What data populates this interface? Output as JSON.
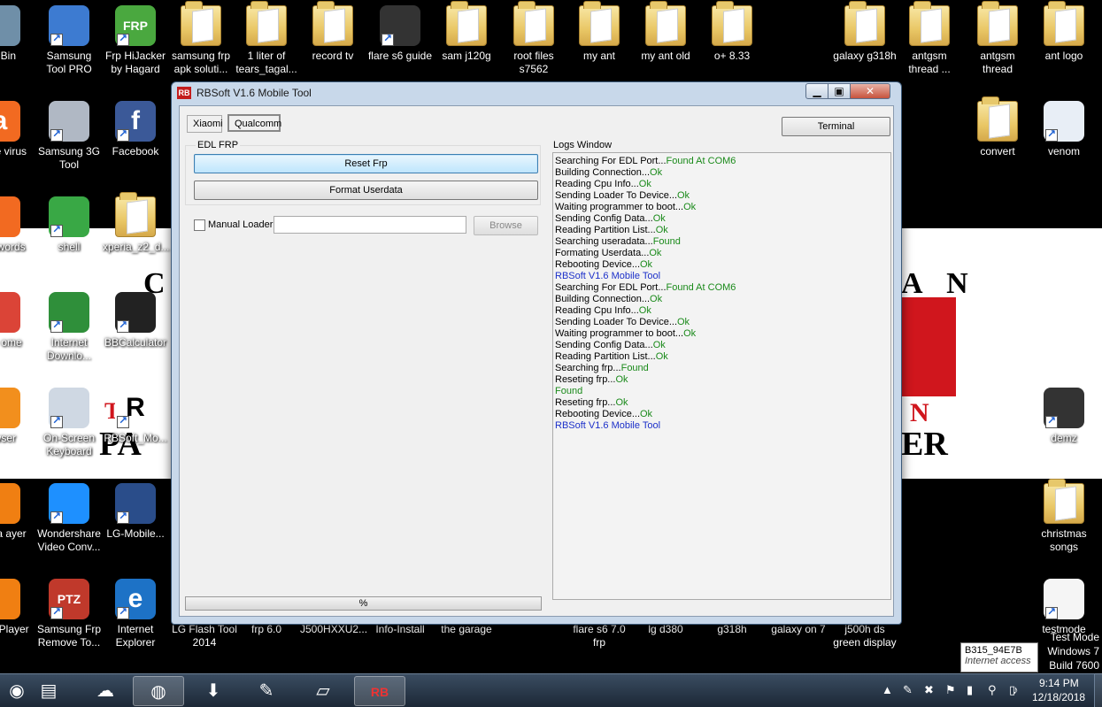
{
  "desktop": {
    "icons": [
      {
        "label": "cle Bin",
        "icon": "recycle-bin-icon"
      },
      {
        "label": "Samsung Tool PRO",
        "icon": "samsung-tool-icon"
      },
      {
        "label": "Frp HiJacker by Hagard",
        "icon": "frp-icon",
        "glyph": "FRP"
      },
      {
        "label": "samsung frp apk soluti...",
        "icon": "folder-icon"
      },
      {
        "label": "1 liter of tears_tagal...",
        "icon": "folder-icon"
      },
      {
        "label": "record tv",
        "icon": "folder-icon"
      },
      {
        "label": "flare s6 guide",
        "icon": "screenshot-icon"
      },
      {
        "label": "sam j120g",
        "icon": "folder-icon"
      },
      {
        "label": "root files s7562",
        "icon": "folder-icon"
      },
      {
        "label": "my ant",
        "icon": "folder-icon"
      },
      {
        "label": "my ant old",
        "icon": "folder-icon"
      },
      {
        "label": "o+ 8.33",
        "icon": "folder-icon"
      },
      {
        "label": "galaxy g318h",
        "icon": "folder-icon"
      },
      {
        "label": "antgsm thread ...",
        "icon": "folder-icon"
      },
      {
        "label": "antgsm thread",
        "icon": "folder-icon"
      },
      {
        "label": "ant logo",
        "icon": "folder-icon"
      },
      {
        "label": "t Free virus",
        "icon": "avast-icon",
        "glyph": "a"
      },
      {
        "label": "Samsung 3G Tool",
        "icon": "gear-icon"
      },
      {
        "label": "Facebook",
        "icon": "facebook-icon",
        "glyph": "f"
      },
      {
        "label": "convert",
        "icon": "folder-icon"
      },
      {
        "label": "venom",
        "icon": "audio-file-icon"
      },
      {
        "label": "vast words",
        "icon": "key-icon"
      },
      {
        "label": "shell",
        "icon": "play-icon"
      },
      {
        "label": "xperia_z2_d...",
        "icon": "folder-icon"
      },
      {
        "label": "ogle ome",
        "icon": "chrome-icon"
      },
      {
        "label": "Internet Downlo...",
        "icon": "download-manager-icon"
      },
      {
        "label": "BBCalculator",
        "icon": "blackberry-icon"
      },
      {
        "label": "rowser",
        "icon": "uc-browser-icon"
      },
      {
        "label": "On-Screen Keyboard",
        "icon": "keyboard-icon"
      },
      {
        "label": "RBSoft_Mo...",
        "icon": "rbsoft-icon",
        "glyph": "R"
      },
      {
        "label": "demz",
        "icon": "video-icon"
      },
      {
        "label": "media ayer",
        "icon": "vlc-icon"
      },
      {
        "label": "Wondershare Video Conv...",
        "icon": "wondershare-icon"
      },
      {
        "label": "LG-Mobile...",
        "icon": "lg-mobile-icon"
      },
      {
        "label": "christmas songs",
        "icon": "folder-icon"
      },
      {
        "label": "dows Player",
        "icon": "media-player-icon"
      },
      {
        "label": "Samsung Frp Remove To...",
        "icon": "ptz-icon",
        "glyph": "PTZ"
      },
      {
        "label": "Internet Explorer",
        "icon": "ie-icon",
        "glyph": "e"
      },
      {
        "label": "LG Flash Tool 2014",
        "icon": "lg-flash-icon"
      },
      {
        "label": "frp 6.0",
        "icon": "folder-icon"
      },
      {
        "label": "J500HXXU2...",
        "icon": "folder-icon"
      },
      {
        "label": "Info-Install",
        "icon": "folder-icon"
      },
      {
        "label": "the garage",
        "icon": "folder-icon"
      },
      {
        "label": "flare s6 7.0 frp",
        "icon": "folder-icon"
      },
      {
        "label": "lg d380",
        "icon": "folder-icon"
      },
      {
        "label": "g318h",
        "icon": "folder-icon"
      },
      {
        "label": "galaxy on 7",
        "icon": "folder-icon"
      },
      {
        "label": "j500h ds green display",
        "icon": "folder-icon"
      },
      {
        "label": "testmode",
        "icon": "text-file-icon"
      }
    ],
    "wallpaper": {
      "left_c": "C",
      "right_an": "A N",
      "right_n": "N",
      "right_er": "ER",
      "left_pa": "PA",
      "left_the": "TH"
    }
  },
  "window": {
    "title": "RBSoft V1.6 Mobile Tool",
    "icon_glyph": "RB",
    "controls": {
      "min": "▁",
      "max": "▣",
      "close": "✕"
    },
    "tabs": [
      {
        "label": "Xiaomi"
      },
      {
        "label": "Qualcomm"
      }
    ],
    "terminal_label": "Terminal",
    "edl_group": "EDL FRP",
    "reset_frp": "Reset Frp",
    "format_userdata": "Format Userdata",
    "manual_loader": "Manual Loader",
    "loader_value": "",
    "browse": "Browse",
    "progress_text": "%",
    "logs_title": "Logs Window",
    "logs": [
      {
        "text": "Searching For EDL Port...",
        "status": "Found At COM6",
        "kind": "ok"
      },
      {
        "text": "Building Connection...",
        "status": "Ok",
        "kind": "ok"
      },
      {
        "text": "Reading Cpu Info...",
        "status": "Ok",
        "kind": "ok"
      },
      {
        "text": "Sending Loader To Device...",
        "status": "Ok",
        "kind": "ok"
      },
      {
        "text": "Waiting programmer to boot...",
        "status": "Ok",
        "kind": "ok"
      },
      {
        "text": "Sending Config Data...",
        "status": "Ok",
        "kind": "ok"
      },
      {
        "text": "Reading Partition List...",
        "status": "Ok",
        "kind": "ok"
      },
      {
        "text": "Searching useradata...",
        "status": "Found",
        "kind": "ok"
      },
      {
        "text": "Formating Userdata...",
        "status": "Ok",
        "kind": "ok"
      },
      {
        "text": "Rebooting Device...",
        "status": "Ok",
        "kind": "ok"
      },
      {
        "text": "",
        "status": "RBSoft V1.6 Mobile Tool",
        "kind": "blue"
      },
      {
        "text": "Searching For EDL Port...",
        "status": "Found At COM6",
        "kind": "ok"
      },
      {
        "text": "Building Connection...",
        "status": "Ok",
        "kind": "ok"
      },
      {
        "text": "Reading Cpu Info...",
        "status": "Ok",
        "kind": "ok"
      },
      {
        "text": "Sending Loader To Device...",
        "status": "Ok",
        "kind": "ok"
      },
      {
        "text": "Waiting programmer to boot...",
        "status": "Ok",
        "kind": "ok"
      },
      {
        "text": "Sending Config Data...",
        "status": "Ok",
        "kind": "ok"
      },
      {
        "text": "Reading Partition List...",
        "status": "Ok",
        "kind": "ok"
      },
      {
        "text": "Searching frp...",
        "status": "Found",
        "kind": "ok"
      },
      {
        "text": "Reseting frp...",
        "status": "Ok",
        "kind": "ok"
      },
      {
        "text": "",
        "status": "Found",
        "kind": "ok"
      },
      {
        "text": "Reseting frp...",
        "status": "Ok",
        "kind": "ok"
      },
      {
        "text": "Rebooting Device...",
        "status": "Ok",
        "kind": "ok"
      },
      {
        "text": "",
        "status": "RBSoft V1.6 Mobile Tool",
        "kind": "blue"
      }
    ]
  },
  "tooltip": {
    "line1": "B315_94E7B",
    "line2": "Internet access"
  },
  "watermark": {
    "line1": "Test Mode",
    "line2": "Windows 7",
    "line3": "Build 7600"
  },
  "taskbar": {
    "items": [
      {
        "icon": "start-orb-icon",
        "glyph": "◉"
      },
      {
        "icon": "explorer-icon",
        "glyph": "▤"
      },
      {
        "icon": "uc-browser-icon",
        "glyph": "☁"
      },
      {
        "icon": "chrome-icon",
        "glyph": "◍"
      },
      {
        "icon": "download-manager-icon",
        "glyph": "⬇"
      },
      {
        "icon": "feather-icon",
        "glyph": "✎"
      },
      {
        "icon": "notepad-icon",
        "glyph": "▱"
      },
      {
        "icon": "rbsoft-icon",
        "glyph": "RB"
      }
    ],
    "tray_icons": [
      {
        "icon": "show-hidden-icon",
        "glyph": "▲"
      },
      {
        "icon": "feather-tray-icon",
        "glyph": "✎"
      },
      {
        "icon": "tool-tray-icon",
        "glyph": "✖"
      },
      {
        "icon": "flag-icon",
        "glyph": "⚑"
      },
      {
        "icon": "signal-icon",
        "glyph": "▮"
      },
      {
        "icon": "usb-icon",
        "glyph": "⚲"
      },
      {
        "icon": "power-icon",
        "glyph": "▯"
      },
      {
        "icon": "volume-icon",
        "glyph": "♪"
      }
    ],
    "time": "9:14 PM",
    "date": "12/18/2018"
  }
}
